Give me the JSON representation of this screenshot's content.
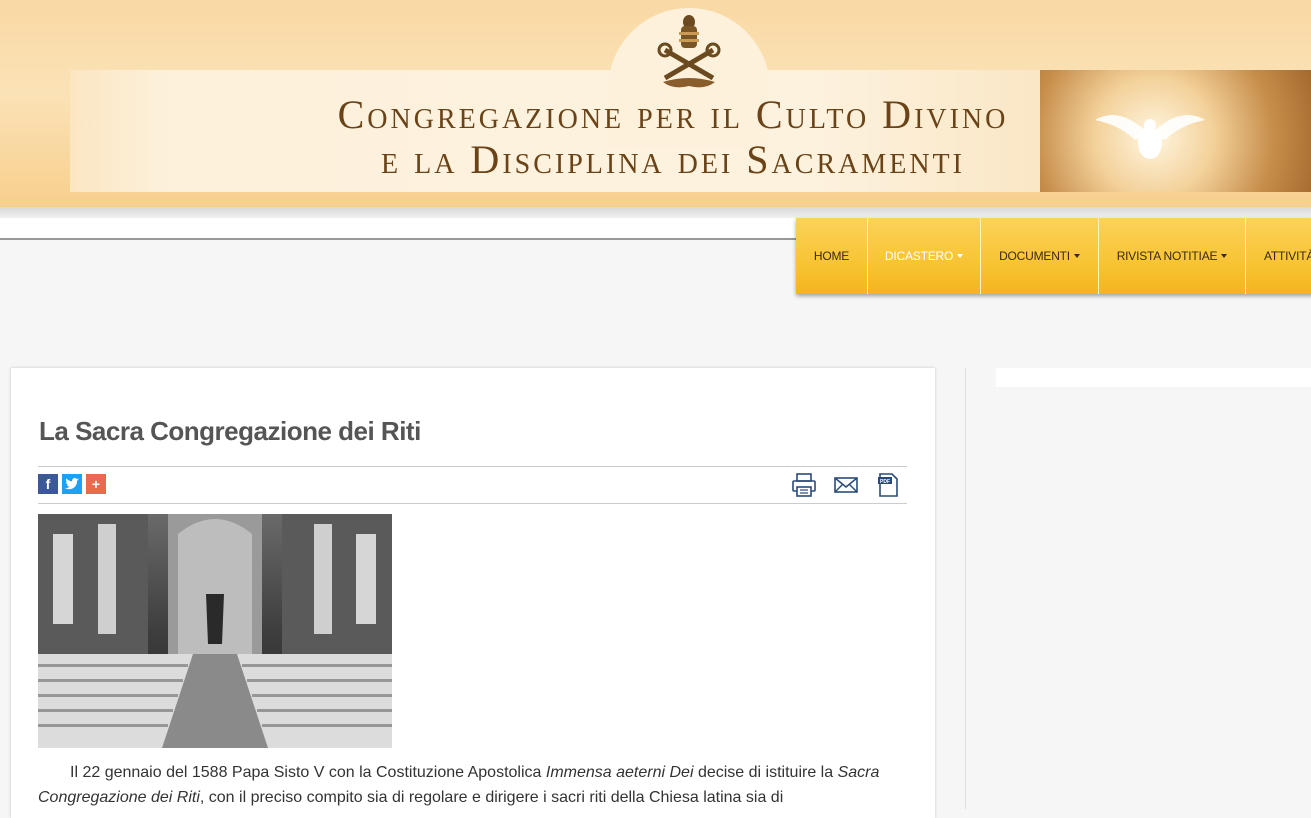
{
  "header": {
    "title_line1": "Congregazione per il Culto Divino",
    "title_line2": "e la Disciplina dei Sacramenti"
  },
  "nav": {
    "items": [
      {
        "label": "HOME",
        "dropdown": false,
        "active": false
      },
      {
        "label": "DICASTERO",
        "dropdown": true,
        "active": true
      },
      {
        "label": "DOCUMENTI",
        "dropdown": true,
        "active": false
      },
      {
        "label": "RIVISTA NOTITIAE",
        "dropdown": true,
        "active": false
      },
      {
        "label": "ATTIVITÀ",
        "dropdown": false,
        "active": false
      }
    ]
  },
  "article": {
    "title": "La Sacra Congregazione dei Riti",
    "paragraph": {
      "p1": "Il 22 gennaio del 1588 Papa Sisto V con la Costituzione Apostolica ",
      "p1_italic": "Immensa aeterni Dei",
      "p2": " decise di istituire la ",
      "p2_italic": "Sacra Congregazione dei Riti",
      "p3": ", con il preciso compito sia di regolare e dirigere i sacri riti della Chiesa latina sia di"
    }
  },
  "share": {
    "facebook": "f",
    "twitter": "t",
    "more": "+"
  },
  "colors": {
    "facebook": "#3b5998",
    "twitter": "#1da1f2",
    "more": "#e96a4f",
    "icon": "#2a4a7a"
  },
  "icons": {
    "print": "print-icon",
    "mail": "mail-icon",
    "pdf": "pdf-icon",
    "pdf_label": "PDF"
  }
}
